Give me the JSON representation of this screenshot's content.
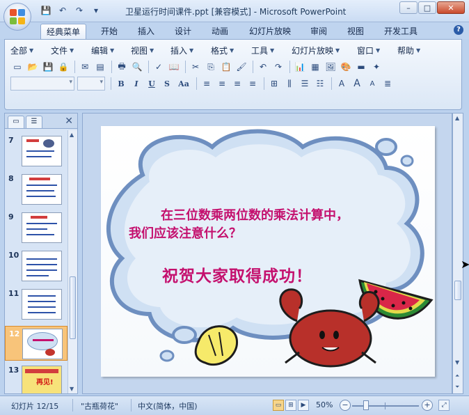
{
  "window": {
    "title": "卫星运行时间课件.ppt [兼容模式] - Microsoft PowerPoint",
    "controls": {
      "minimize": "–",
      "maximize": "□",
      "close": "✕"
    }
  },
  "quick_access": {
    "save": "💾",
    "undo": "↶",
    "redo": "↷",
    "customize": "▾"
  },
  "tabs": [
    {
      "label": "经典菜单",
      "active": true
    },
    {
      "label": "开始"
    },
    {
      "label": "插入"
    },
    {
      "label": "设计"
    },
    {
      "label": "动画"
    },
    {
      "label": "幻灯片放映"
    },
    {
      "label": "审阅"
    },
    {
      "label": "视图"
    },
    {
      "label": "开发工具"
    }
  ],
  "help_icon": "?",
  "menus": [
    "全部",
    "文件",
    "编辑",
    "视图",
    "插入",
    "格式",
    "工具",
    "幻灯片放映",
    "窗口",
    "帮助"
  ],
  "toolbar_row1_icons": [
    "new-icon",
    "open-icon",
    "save-icon",
    "permission-icon",
    "email-icon",
    "pdf-icon",
    "print-icon",
    "print-preview-icon",
    "spelling-icon",
    "research-icon",
    "cut-icon",
    "copy-icon",
    "paste-icon",
    "format-painter-icon",
    "undo-icon",
    "redo-icon",
    "chart-icon",
    "table-icon",
    "picture-icon",
    "color-icon",
    "background-icon",
    "new-slide-icon"
  ],
  "toolbar_row1_glyphs": [
    "▭",
    "📂",
    "💾",
    "🔒",
    "✉",
    "▤",
    "🖶",
    "🔍",
    "✓",
    "📖",
    "✂",
    "⎘",
    "📋",
    "🖌",
    "↶",
    "↷",
    "📊",
    "▦",
    "🖼",
    "🎨",
    "▬",
    "✦"
  ],
  "format_buttons": [
    {
      "name": "bold-button",
      "label": "B"
    },
    {
      "name": "italic-button",
      "label": "I"
    },
    {
      "name": "underline-button",
      "label": "U"
    },
    {
      "name": "shadow-button",
      "label": "S"
    },
    {
      "name": "change-case-button",
      "label": "Aa"
    }
  ],
  "align_glyphs": [
    "≡",
    "≡",
    "≡",
    "≡",
    "⊞",
    "⫼",
    "☰",
    "☷",
    "A",
    "A",
    "A",
    "≣"
  ],
  "slides_panel": {
    "close": "✕",
    "items": [
      {
        "num": "7"
      },
      {
        "num": "8"
      },
      {
        "num": "9"
      },
      {
        "num": "10"
      },
      {
        "num": "11"
      },
      {
        "num": "12",
        "selected": true
      },
      {
        "num": "13",
        "caption": "再见!"
      }
    ]
  },
  "slide": {
    "line1": "在三位数乘两位数的乘法计算中，",
    "line2": "我们应该注意什么？",
    "line3": "祝贺大家取得成功！",
    "text_color": "#c4106e"
  },
  "status": {
    "slide_pos": "幻灯片 12/15",
    "theme": "\"古瓶荷花\"",
    "language": "中文(简体，中国)",
    "zoom": "50%",
    "zoom_out": "−",
    "zoom_in": "+"
  }
}
